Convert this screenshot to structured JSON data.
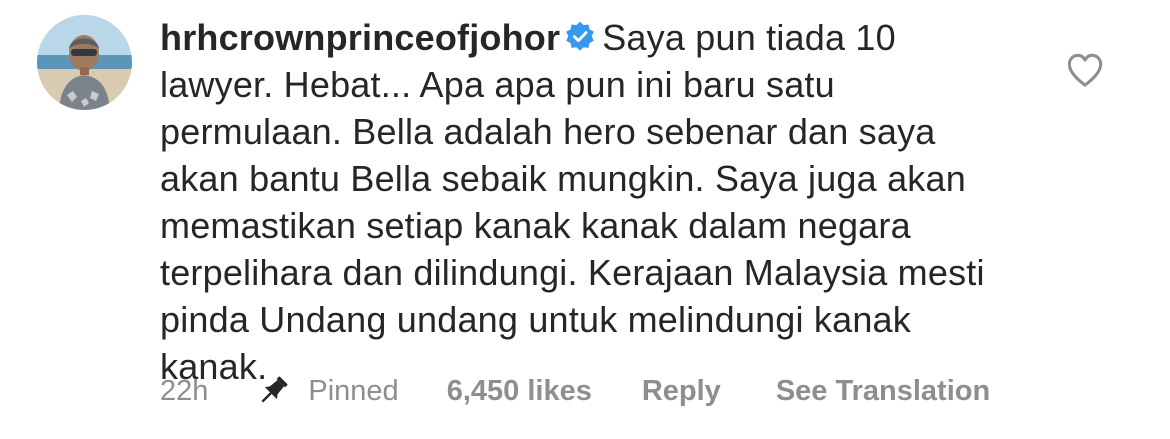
{
  "comment": {
    "username": "hrhcrownprinceofjohor",
    "verified": true,
    "text": "Saya pun tiada 10 lawyer. Hebat... Apa apa pun ini baru satu permulaan. Bella adalah hero sebenar dan saya akan bantu Bella sebaik mungkin. Saya juga akan memastikan setiap kanak kanak dalam negara terpelihara dan dilindungi. Kerajaan Malaysia mesti pinda Undang undang untuk melindungi kanak kanak.",
    "time": "22h",
    "pinned_label": "Pinned",
    "likes": "6,450 likes",
    "reply_label": "Reply",
    "translation_label": "See Translation"
  },
  "icons": {
    "avatar": "avatar-photo",
    "verified": "verified-badge-icon",
    "like": "heart-outline-icon",
    "pin": "pin-icon"
  },
  "colors": {
    "text": "#262626",
    "secondary": "#8e8e8e",
    "verified": "#3897f0"
  }
}
